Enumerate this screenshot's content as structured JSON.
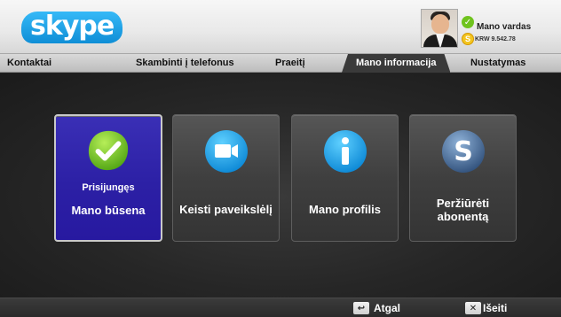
{
  "header": {
    "logo_text": "skype",
    "user_name": "Mano vardas",
    "credit": "KRW 9.542.78"
  },
  "tabs": [
    {
      "label": "Kontaktai",
      "active": false
    },
    {
      "label": "Skambinti į telefonus",
      "active": false
    },
    {
      "label": "Praeitį",
      "active": false
    },
    {
      "label": "Mano informacija",
      "active": true
    },
    {
      "label": "Nustatymas",
      "active": false
    }
  ],
  "tiles": [
    {
      "sublabel": "Prisijungęs",
      "label": "Mano būsena",
      "icon": "status-check-icon",
      "selected": true
    },
    {
      "label": "Keisti paveikslėlį",
      "icon": "camera-icon",
      "selected": false
    },
    {
      "label": "Mano profilis",
      "icon": "info-icon",
      "selected": false
    },
    {
      "label_line1": "Peržiūrėti",
      "label_line2": "abonentą",
      "icon": "skype-s-icon",
      "selected": false
    }
  ],
  "footer": {
    "back_key": "↩",
    "back_label": "Atgal",
    "exit_key": "✕",
    "exit_label": "Išeiti"
  },
  "colors": {
    "selected_tile": "#2c20a5",
    "status_online": "#6fc31e",
    "skype_blue": "#12a5f0"
  }
}
